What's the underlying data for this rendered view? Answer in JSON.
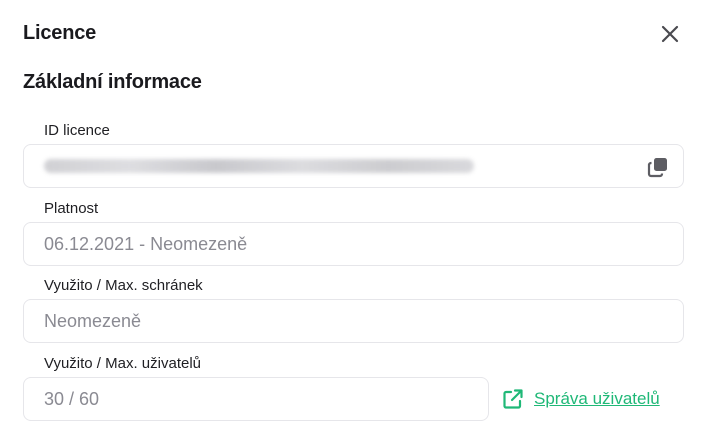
{
  "dialog": {
    "title": "Licence",
    "close_icon": "close-icon"
  },
  "section": {
    "title": "Základní informace"
  },
  "fields": {
    "license_id": {
      "label": "ID licence",
      "value": "",
      "value_blurred": true,
      "copy_icon": "copy-icon"
    },
    "validity": {
      "label": "Platnost",
      "value": "06.12.2021 - Neomezeně"
    },
    "mailboxes": {
      "label": "Využito / Max. schránek",
      "value": "Neomezeně"
    },
    "users": {
      "label": "Využito / Max. uživatelů",
      "value": "30 / 60"
    }
  },
  "manage_users_link": {
    "label": "Správa uživatelů",
    "icon": "external-link-icon"
  },
  "colors": {
    "accent": "#1fb877",
    "border": "#e6e6ea",
    "muted_text": "#8a8a92"
  }
}
